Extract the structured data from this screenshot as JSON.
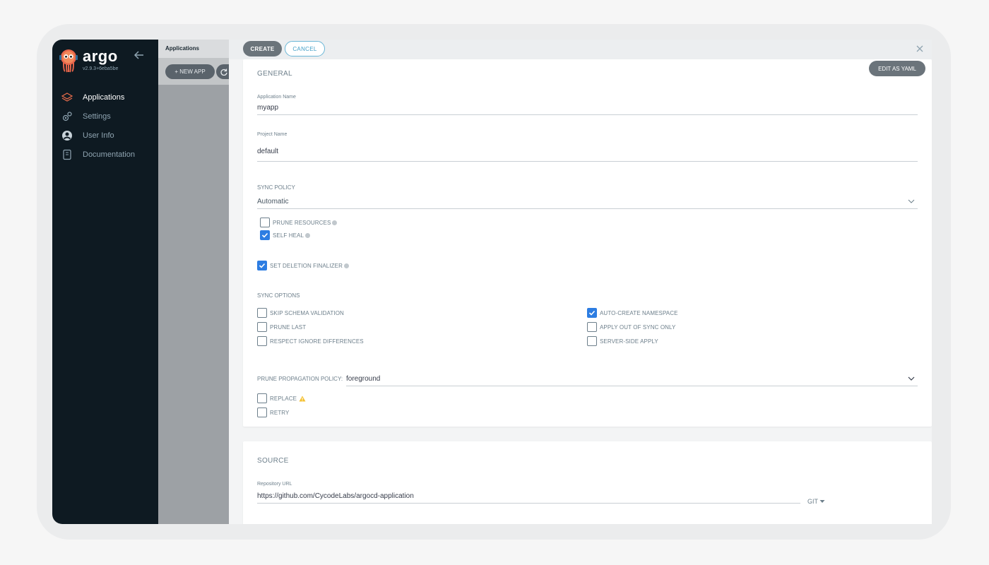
{
  "sidebar": {
    "brand": "argo",
    "version": "v2.9.3+6eba5be",
    "items": [
      {
        "label": "Applications",
        "icon": "layers-icon"
      },
      {
        "label": "Settings",
        "icon": "gears-icon"
      },
      {
        "label": "User Info",
        "icon": "user-circle-icon"
      },
      {
        "label": "Documentation",
        "icon": "book-icon"
      }
    ]
  },
  "apps_column": {
    "title": "Applications",
    "new_app_label": "+ NEW APP"
  },
  "panel": {
    "create_label": "CREATE",
    "cancel_label": "CANCEL",
    "edit_yaml_label": "EDIT AS YAML"
  },
  "general": {
    "title": "GENERAL",
    "app_name_label": "Application Name",
    "app_name_value": "myapp",
    "project_label": "Project Name",
    "project_value": "default",
    "sync_policy_title": "SYNC POLICY",
    "sync_policy_value": "Automatic",
    "prune_resources_label": "PRUNE RESOURCES",
    "prune_resources_checked": false,
    "self_heal_label": "SELF HEAL",
    "self_heal_checked": true,
    "deletion_finalizer_label": "SET DELETION FINALIZER",
    "deletion_finalizer_checked": true
  },
  "sync_options": {
    "title": "SYNC OPTIONS",
    "skip_schema": {
      "label": "SKIP SCHEMA VALIDATION",
      "checked": false
    },
    "auto_create_ns": {
      "label": "AUTO-CREATE NAMESPACE",
      "checked": true
    },
    "prune_last": {
      "label": "PRUNE LAST",
      "checked": false
    },
    "apply_out_of_sync": {
      "label": "APPLY OUT OF SYNC ONLY",
      "checked": false
    },
    "respect_ignore": {
      "label": "RESPECT IGNORE DIFFERENCES",
      "checked": false
    },
    "server_side_apply": {
      "label": "SERVER-SIDE APPLY",
      "checked": false
    },
    "prune_propagation_label": "PRUNE PROPAGATION POLICY:",
    "prune_propagation_value": "foreground",
    "replace": {
      "label": "REPLACE",
      "checked": false
    },
    "retry": {
      "label": "RETRY",
      "checked": false
    }
  },
  "source": {
    "title": "SOURCE",
    "repo_url_label": "Repository URL",
    "repo_url_value": "https://github.com/CycodeLabs/argocd-application",
    "repo_type": "GIT"
  },
  "colors": {
    "sidebar_bg": "#0e1a22",
    "accent_checkbox": "#2d7de2",
    "active_icon": "#e96d4c",
    "warning": "#f4c030"
  }
}
